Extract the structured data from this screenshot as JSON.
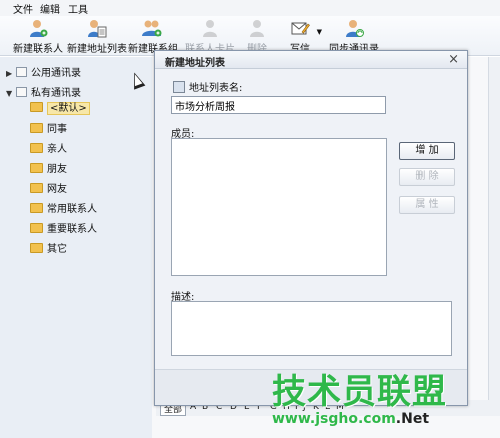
{
  "menu": [
    "文件",
    "编辑",
    "工具"
  ],
  "toolbar": [
    {
      "label": "新建联系人",
      "icon": "new-contact-icon",
      "enabled": true
    },
    {
      "label": "新建地址列表",
      "icon": "new-list-icon",
      "enabled": true
    },
    {
      "label": "新建联系组",
      "icon": "new-group-icon",
      "enabled": true
    },
    {
      "label": "联系人卡片",
      "icon": "contact-card-icon",
      "enabled": false
    },
    {
      "label": "删除",
      "icon": "delete-icon",
      "enabled": false
    },
    {
      "label": "写信",
      "icon": "write-mail-icon",
      "enabled": true
    },
    {
      "label": "同步通讯录",
      "icon": "sync-icon",
      "enabled": true
    }
  ],
  "sidebar": {
    "public_book": "公用通讯录",
    "private_book": "私有通讯录",
    "folders": [
      "<默认>",
      "同事",
      "亲人",
      "朋友",
      "网友",
      "常用联系人",
      "重要联系人",
      "其它"
    ],
    "selected": "<默认>"
  },
  "alphabet": [
    "全部",
    "A",
    "B",
    "C",
    "D",
    "E",
    "F",
    "G",
    "H",
    "I",
    "J",
    "K",
    "L",
    "M"
  ],
  "dialog": {
    "title": "新建地址列表",
    "close": "×",
    "name_label": "地址列表名:",
    "name_value": "市场分析周报",
    "members_label": "成员:",
    "add_button": "增 加",
    "remove_button": "删 除",
    "properties_button": "属 性",
    "description_label": "描述:"
  },
  "watermark": {
    "main": "技术员联盟",
    "url_prefix": "www.jsgho.com",
    "url_suffix": ".Net",
    "accent": "#2fb84a"
  }
}
